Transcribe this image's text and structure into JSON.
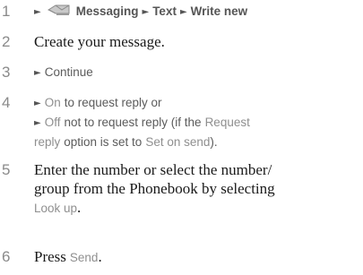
{
  "steps": [
    {
      "number": "1",
      "nav": {
        "arrow": "►",
        "icon": "messaging-envelope-icon",
        "messaging": "Messaging",
        "text": "Text",
        "write_new": "Write new"
      }
    },
    {
      "number": "2",
      "text": "Create your message."
    },
    {
      "number": "3",
      "arrow": "►",
      "continue": "Continue"
    },
    {
      "number": "4",
      "arrow": "►",
      "on": "On",
      "to_request": "to request reply or",
      "off": "Off",
      "not_request": "not to request reply (if the",
      "request": "Request",
      "reply": "reply",
      "option_set_to": "option is set to",
      "set_on_send": "Set on send",
      "close": ")."
    },
    {
      "number": "5",
      "line1": "Enter the number or select the number/",
      "line2": "group from the Phonebook by selecting",
      "look_up": "Look up",
      "period": "."
    },
    {
      "number": "6",
      "press": "Press",
      "send": "Send",
      "period": "."
    }
  ],
  "colors": {
    "number": "#8a8a8a",
    "body_text": "#1a1a1a",
    "menu_path": "#555555",
    "ui_label": "#8f8f8f"
  }
}
